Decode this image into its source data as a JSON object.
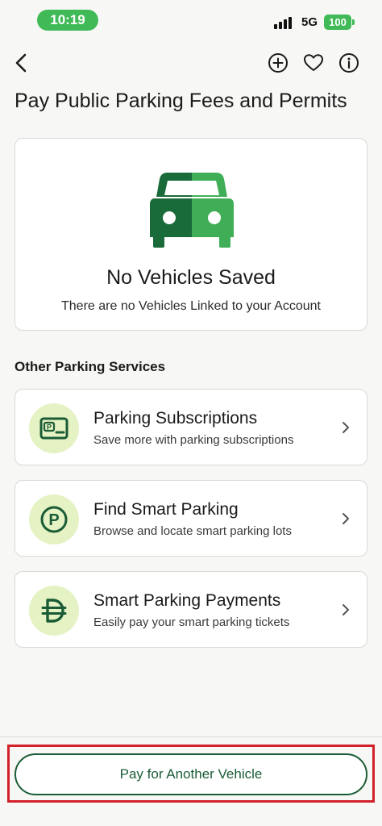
{
  "status_bar": {
    "time": "10:19",
    "network": "5G",
    "battery": "100"
  },
  "nav": {
    "back_icon": "chevron-left-icon",
    "add_icon": "plus-circle-icon",
    "favorite_icon": "heart-icon",
    "info_icon": "info-icon"
  },
  "page": {
    "title": "Pay Public Parking Fees and Permits"
  },
  "empty_state": {
    "icon": "car-icon",
    "title": "No Vehicles Saved",
    "subtitle": "There are no Vehicles Linked to your Account"
  },
  "services": {
    "section_title": "Other Parking Services",
    "items": [
      {
        "title": "Parking Subscriptions",
        "subtitle": "Save more with parking subscriptions",
        "icon": "parking-card-icon"
      },
      {
        "title": "Find Smart Parking",
        "subtitle": "Browse and locate smart parking lots",
        "icon": "parking-circle-icon"
      },
      {
        "title": "Smart Parking Payments",
        "subtitle": "Easily pay your smart parking tickets",
        "icon": "dirham-currency-icon"
      }
    ]
  },
  "footer": {
    "primary_button": "Pay for Another Vehicle"
  },
  "colors": {
    "accent_green": "#3fba57",
    "dark_green": "#1a5c36",
    "icon_bg": "#e5f2c4",
    "highlight_red": "#d3202a"
  }
}
